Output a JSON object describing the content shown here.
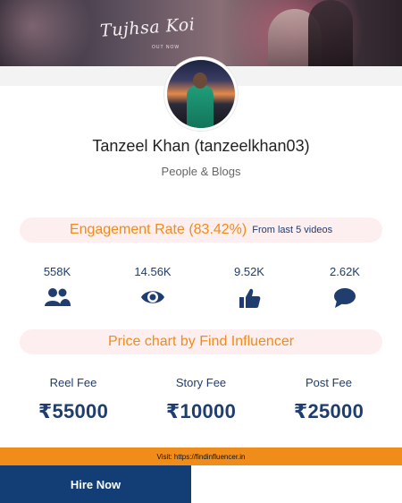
{
  "banner": {
    "title": "Tujhsa Koi",
    "subtitle": "OUT NOW"
  },
  "profile": {
    "name": "Tanzeel Khan (tanzeelkhan03)",
    "category": "People & Blogs"
  },
  "engagement": {
    "rate_label": "Engagement Rate (83.42%)",
    "note": "From last 5 videos"
  },
  "stats": [
    {
      "value": "558K",
      "icon": "users-icon"
    },
    {
      "value": "14.56K",
      "icon": "eye-icon"
    },
    {
      "value": "9.52K",
      "icon": "thumbs-up-icon"
    },
    {
      "value": "2.62K",
      "icon": "comment-icon"
    }
  ],
  "price_chart": {
    "title": "Price chart by Find Influencer",
    "fees": [
      {
        "label": "Reel Fee",
        "amount": "₹55000"
      },
      {
        "label": "Story Fee",
        "amount": "₹10000"
      },
      {
        "label": "Post Fee",
        "amount": "₹25000"
      }
    ]
  },
  "footer": {
    "visit_text": "Visit: https://findinfluencer.in",
    "hire_label": "Hire Now"
  },
  "colors": {
    "accent": "#f08c1a",
    "navy": "#1f3d6e",
    "button": "#123e75",
    "pill_bg": "#fdeef0"
  }
}
